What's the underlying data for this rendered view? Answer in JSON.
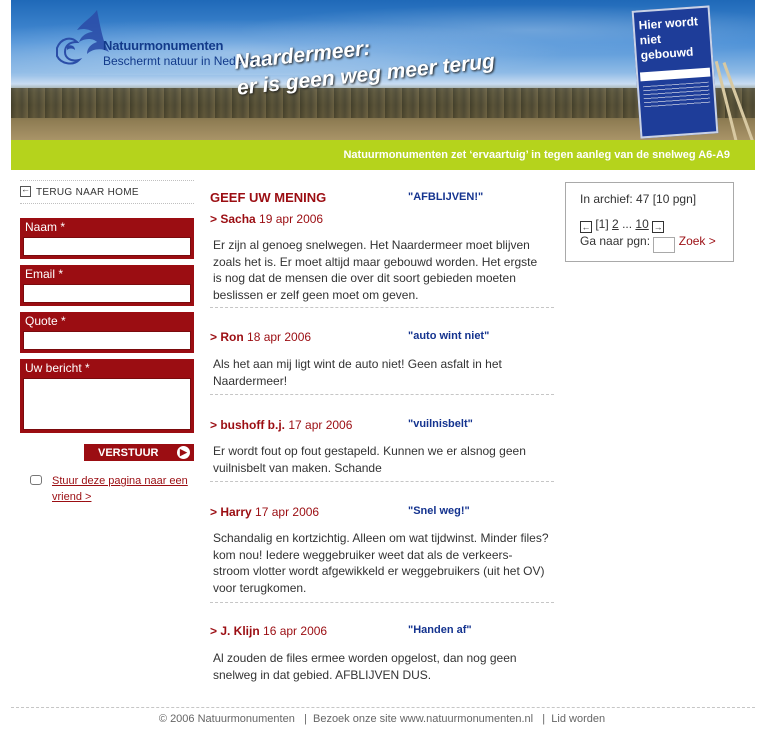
{
  "header": {
    "brand_name": "Natuurmonumenten",
    "brand_tagline": "Beschermt natuur in Nederland",
    "headline_line1": "Naardermeer:",
    "headline_line2": "er is geen weg meer terug",
    "sign_text": "Hier wordt niet gebouwd",
    "subtitle": "Natuurmonumenten zet ‘ervaartuig’ in tegen aanleg van de snelweg A6-A9",
    "accent_green": "#b5d31c",
    "brand_red": "#9b0d12",
    "brand_blue": "#14338f"
  },
  "sidebar": {
    "back_label": "TERUG NAAR HOME",
    "fields": [
      {
        "label": "Naam *",
        "value": ""
      },
      {
        "label": "Email *",
        "value": ""
      },
      {
        "label": "Quote *",
        "value": ""
      },
      {
        "label": "Uw bericht *",
        "value": ""
      }
    ],
    "submit_label": "VERSTUUR",
    "friend_link": "Stuur deze pagina naar een vriend",
    "friend_suffix": ">"
  },
  "main": {
    "heading": "GEEF UW MENING",
    "entries": [
      {
        "author": "> Sacha",
        "date": "19 apr 2006",
        "title": "\"AFBLIJVEN!\"",
        "text": "Er zijn al genoeg snelwegen. Het Naardermeer moet blijven zoals het is. Er moet altijd maar gebouwd worden. Het ergste is nog dat de mensen die over dit soort gebieden moeten beslissen er zelf geen moet om geven."
      },
      {
        "author": "> Ron",
        "date": "18 apr 2006",
        "title": "\"auto wint niet\"",
        "text": "Als het aan mij ligt wint de auto niet! Geen asfalt in het Naardermeer!"
      },
      {
        "author": "> bushoff b.j.",
        "date": "17 apr 2006",
        "title": "\"vuilnisbelt\"",
        "text": "Er wordt fout op fout gestapeld. Kunnen we er alsnog geen vuilnisbelt van maken. Schande"
      },
      {
        "author": "> Harry",
        "date": "17 apr 2006",
        "title": "\"Snel weg!\"",
        "text": "Schandalig en kortzichtig. Alleen om wat tijdwinst. Minder files? kom nou! Iedere weggebruiker weet dat als de verkeers-stroom vlotter wordt afgewikkeld er weggebruikers (uit het OV) voor terugkomen."
      },
      {
        "author": "> J. Klijn",
        "date": "16 apr 2006",
        "title": "\"Handen af\"",
        "text": "Al zouden de files ermee worden opgelost, dan nog geen snelweg in dat gebied. AFBLIJVEN DUS."
      }
    ]
  },
  "archive": {
    "count_label": "In archief: 47 [10 pgn]",
    "current_page": "[1]",
    "page_2": "2",
    "ellipsis": "...",
    "last_page": "10",
    "goto_label": "Ga naar pgn:",
    "goto_value": "",
    "search_label": "Zoek >"
  },
  "footer": {
    "copyright": "© 2006 Natuurmonumenten",
    "sep": "|",
    "visit": "Bezoek onze site www.natuurmonumenten.nl",
    "join": "Lid worden"
  }
}
